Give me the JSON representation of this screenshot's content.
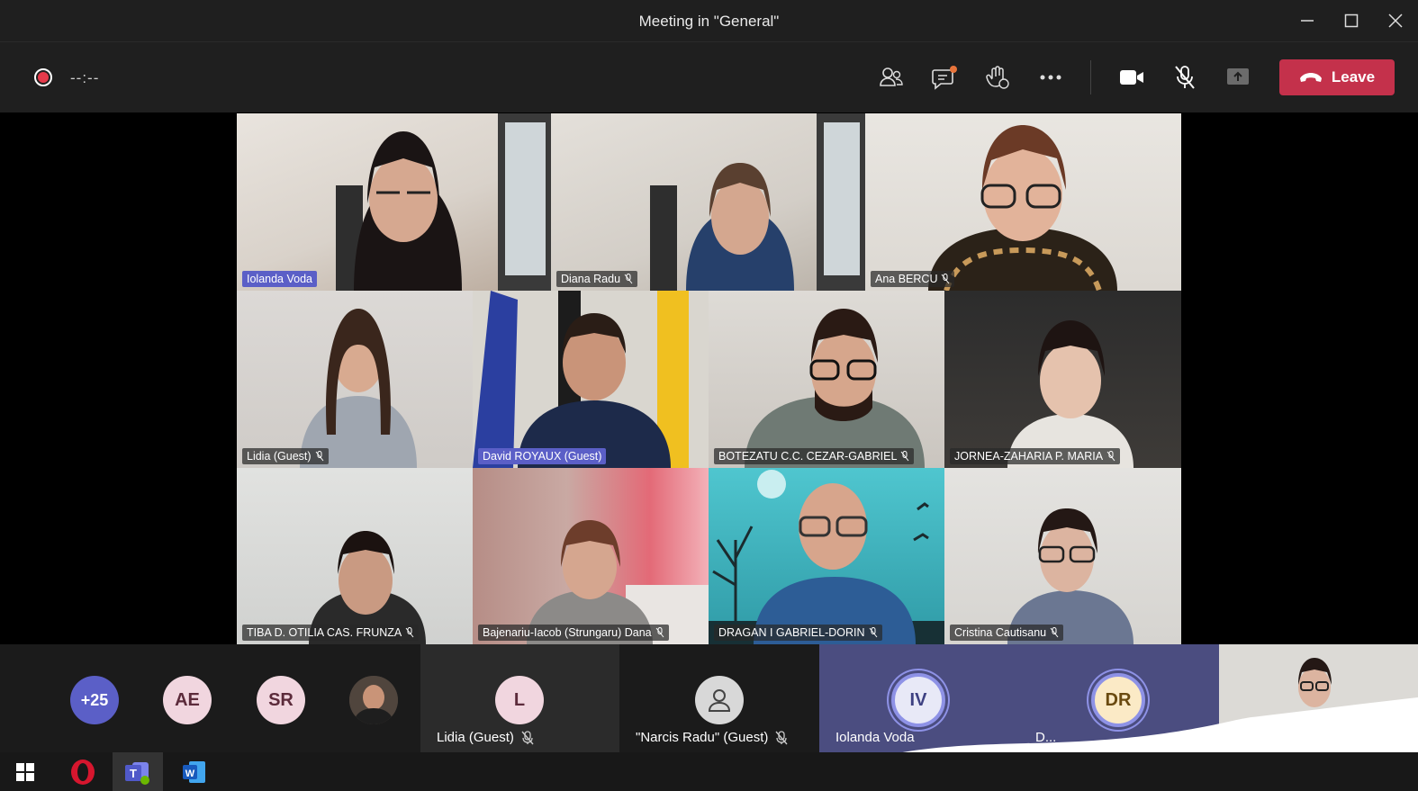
{
  "window": {
    "title": "Meeting in \"General\"",
    "controls": {
      "minimize_icon": "minimize-icon",
      "maximize_icon": "maximize-icon",
      "close_icon": "close-icon"
    }
  },
  "toolbar": {
    "timer": "--:--",
    "leave_label": "Leave",
    "accent_leave": "#c4314b",
    "icons": [
      "participants-icon",
      "chat-icon",
      "reactions-icon",
      "more-options-icon",
      "camera-icon",
      "mic-off-icon",
      "share-icon"
    ]
  },
  "grid": {
    "tiles": [
      {
        "name": "Iolanda Voda",
        "active": true
      },
      {
        "name": "Diana Radu"
      },
      {
        "name": "Ana BERCU"
      },
      {
        "name": "Lidia (Guest)"
      },
      {
        "name": "David ROYAUX (Guest)",
        "active": true
      },
      {
        "name": "BOTEZATU C.C. CEZAR-GABRIEL"
      },
      {
        "name": "JORNEA-ZAHARIA P. MARIA"
      },
      {
        "name": "TIBA D. OTILIA CAS. FRUNZA"
      },
      {
        "name": "Bajenariu-Iacob (Strungaru) Dana"
      },
      {
        "name": "DRAGAN I GABRIEL-DORIN"
      },
      {
        "name": "Cristina Cautisanu"
      }
    ]
  },
  "strip": {
    "overflow_count": "+25",
    "avatars": [
      "AE",
      "SR"
    ],
    "participants": [
      {
        "initial": "L",
        "name": "Lidia (Guest)"
      },
      {
        "name": "\"Narcis Radu\" (Guest)"
      },
      {
        "initials": "IV",
        "name": "Iolanda Voda"
      },
      {
        "initials": "DR",
        "name": "D... "
      }
    ]
  },
  "colors": {
    "brand_purple": "#5b5fc7",
    "overflow_bg": "#5b5fc7",
    "avatar_pink": "#f1d6df",
    "iv_bg": "#e8e9f7",
    "dr_bg": "#fbeac6"
  }
}
